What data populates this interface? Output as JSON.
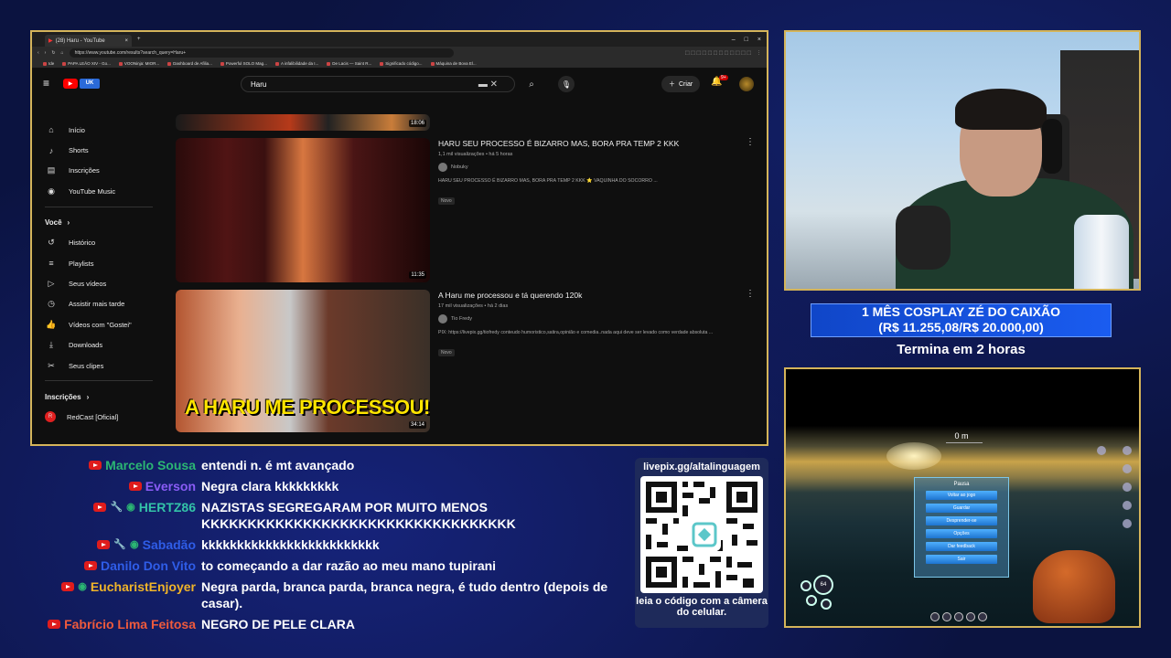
{
  "browser": {
    "tab_title": "(28) Haru - YouTube",
    "url": "https://www.youtube.com/results?search_query=Haru+",
    "bookmarks": [
      "Ide",
      "PAPA LEÃO XIV - Go...",
      "VOONinja: MIOR...",
      "Dashboard de Afilia...",
      "Powerful SOLO Mag...",
      "A infalibilidade da I...",
      "De Lacis — Saint R...",
      "Significado código...",
      "Máquina de Bova El..."
    ]
  },
  "youtube": {
    "search_value": "Haru",
    "create_label": "Criar",
    "notif_count": "9+",
    "sidebar": {
      "top": [
        {
          "label": "Início",
          "icon": "home-icon",
          "glyph": "⌂"
        },
        {
          "label": "Shorts",
          "icon": "shorts-icon",
          "glyph": "♪"
        },
        {
          "label": "Inscrições",
          "icon": "subscriptions-icon",
          "glyph": "▤"
        },
        {
          "label": "YouTube Music",
          "icon": "music-icon",
          "glyph": "◉"
        }
      ],
      "you_heading": "Você",
      "you": [
        {
          "label": "Histórico",
          "icon": "history-icon",
          "glyph": "↺"
        },
        {
          "label": "Playlists",
          "icon": "playlists-icon",
          "glyph": "≡"
        },
        {
          "label": "Seus vídeos",
          "icon": "your-videos-icon",
          "glyph": "▷"
        },
        {
          "label": "Assistir mais tarde",
          "icon": "watch-later-icon",
          "glyph": "◷"
        },
        {
          "label": "Vídeos com \"Gostei\"",
          "icon": "like-icon",
          "glyph": "👍"
        },
        {
          "label": "Downloads",
          "icon": "download-icon",
          "glyph": "⤓"
        },
        {
          "label": "Seus clipes",
          "icon": "clips-icon",
          "glyph": "✂"
        }
      ],
      "subs_heading": "Inscrições",
      "subs": [
        {
          "label": "RedCast [Oficial]"
        }
      ]
    },
    "videos": [
      {
        "duration": "18:06"
      },
      {
        "title": "HARU SEU PROCESSO É BIZARRO MAS, BORA PRA TEMP 2 KKK",
        "meta": "1,1 mil visualizações • há 5 horas",
        "channel": "Nobuky",
        "desc": "HARU SEU PROCESSO É BIZARRO MAS, BORA PRA TEMP 2 KKK ⭐ VAQUINHA DO SOCORRO ...",
        "badge": "Novo",
        "duration": "11:35"
      },
      {
        "title": "A Haru me processou e tá querendo 120k",
        "meta": "17 mil visualizações • há 2 dias",
        "channel": "Tio Fredy",
        "desc": "PIX: https://livepix.gg/tiofredy conteudo humoristico,satira,opinião e comedia..nada aqui deve ser levado como verdade absoluta ...",
        "badge": "Novo",
        "duration": "34:14",
        "thumb_text": "A HARU ME PROCESSOU!"
      }
    ]
  },
  "goal": {
    "line1": "1 MÊS COSPLAY ZÉ DO CAIXÃO",
    "line2": "(R$ 11.255,08/R$ 20.000,00)",
    "progress": 0.563,
    "sub": "Termina em 2 horas"
  },
  "game": {
    "depth": "0 m",
    "pause_title": "Pausa",
    "buttons": [
      "Voltar ao jogo",
      "Guardar",
      "Desprender-se",
      "Opções",
      "Dar feedback",
      "Sair"
    ],
    "vital": "64"
  },
  "chat": [
    {
      "user": "Marcelo Sousa",
      "color": "#2bb673",
      "wrench": false,
      "dollar": false,
      "text": "entendi n. é mt avançado"
    },
    {
      "user": "Everson",
      "color": "#8a5cf6",
      "wrench": false,
      "dollar": false,
      "text": "Negra clara kkkkkkkkk"
    },
    {
      "user": "HERTZ86",
      "color": "#33c3a8",
      "wrench": true,
      "dollar": true,
      "text": "NAZISTAS SEGREGARAM POR MUITO MENOS KKKKKKKKKKKKKKKKKKKKKKKKKKKKKKKKKK"
    },
    {
      "user": "Sabadão",
      "color": "#2f5de8",
      "wrench": true,
      "dollar": true,
      "text": "kkkkkkkkkkkkkkkkkkkkkkkkk"
    },
    {
      "user": "Danilo Don Vito",
      "color": "#2f5de8",
      "wrench": false,
      "dollar": false,
      "text": "to começando a dar razão ao meu mano tupirani"
    },
    {
      "user": "EucharistEnjoyer",
      "color": "#f0b429",
      "wrench": false,
      "dollar": true,
      "text": "Negra parda, branca parda, branca negra, é tudo dentro (depois de casar)."
    },
    {
      "user": "Fabrício Lima Feitosa",
      "color": "#ef5a3c",
      "wrench": false,
      "dollar": false,
      "text": "NEGRO DE PELE CLARA"
    }
  ],
  "qr": {
    "url": "livepix.gg/altalinguagem",
    "caption": "leia o código com a câmera do celular."
  }
}
